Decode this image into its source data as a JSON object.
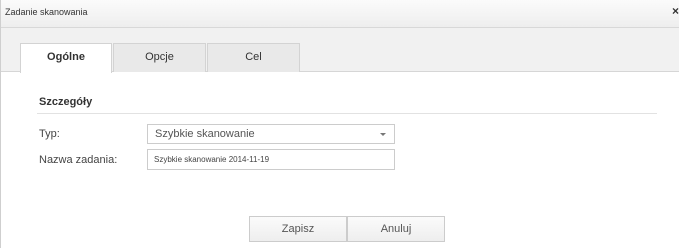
{
  "dialog": {
    "title": "Zadanie skanowania",
    "close_glyph": "×"
  },
  "tabs": [
    {
      "label": "Ogólne",
      "active": true
    },
    {
      "label": "Opcje",
      "active": false
    },
    {
      "label": "Cel",
      "active": false
    }
  ],
  "details": {
    "section_title": "Szczegóły",
    "type_label": "Typ:",
    "type_value": "Szybkie skanowanie",
    "name_label": "Nazwa zadania:",
    "name_value": "Szybkie skanowanie 2014-11-19"
  },
  "buttons": {
    "save": "Zapisz",
    "cancel": "Anuluj"
  }
}
